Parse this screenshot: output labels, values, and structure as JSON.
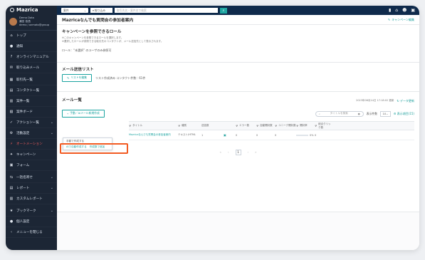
{
  "app": {
    "logo": "Mazrica"
  },
  "user": {
    "line1": "Demo Data",
    "line2": "瀬田 音昌",
    "line3": "demo / azmato@group"
  },
  "sidebar": {
    "items": [
      {
        "label": "トップ",
        "icon": "home-icon"
      },
      {
        "label": "通知",
        "icon": "bell-icon"
      },
      {
        "label": "オンラインマニュアル",
        "icon": "help-icon"
      },
      {
        "label": "取り込みメール",
        "icon": "mail-icon"
      },
      {
        "label": "取引先一覧",
        "icon": "building-icon"
      },
      {
        "label": "コンタクト一覧",
        "icon": "contact-icon"
      },
      {
        "label": "案件一覧",
        "icon": "list-icon"
      },
      {
        "label": "案件ボード",
        "icon": "board-icon"
      },
      {
        "label": "アクション一覧",
        "icon": "check-icon",
        "chevron": true
      },
      {
        "label": "活動設定",
        "icon": "settings-icon",
        "chevron": true
      },
      {
        "label": "オートメーション",
        "icon": "bolt-icon",
        "active": true
      },
      {
        "label": "キャンペーン",
        "icon": "campaign-icon"
      },
      {
        "label": "フォーム",
        "icon": "form-icon"
      },
      {
        "label": "一括名寄せ",
        "icon": "merge-icon",
        "chevron": true
      },
      {
        "label": "レポート",
        "icon": "report-icon",
        "chevron": true
      },
      {
        "label": "カスタムレポート",
        "icon": "chart-icon"
      },
      {
        "label": "ブックマーク",
        "icon": "star-icon",
        "chevron": true
      },
      {
        "label": "個人設定",
        "icon": "person-icon"
      },
      {
        "label": "メニューを閉じる",
        "icon": "back-icon"
      }
    ]
  },
  "topbar": {
    "scope": "案件",
    "filter": "絞り込み",
    "search_placeholder": "取引先名・案件名で検索"
  },
  "page": {
    "title": "Mazricaなんでも質問会の参加者案内",
    "edit": "キャンペーン編集"
  },
  "roles": {
    "heading": "キャンペーンを参照できるロール",
    "desc1": "※このキャンペーンを参照できるロールを選択します。",
    "desc2": "※選択したロールが参照できる取引先のコンタクトが、メール送信先として表示されます。",
    "value": "ロール：“未選択” のユーザのみ参照可"
  },
  "sendlist": {
    "heading": "メール送信リスト",
    "button": "リストを編集",
    "status": "リスト作成済み コンタクト件数：61件"
  },
  "mail": {
    "heading": "メール一覧",
    "timestamp": "2023年06月14日 17:18:02 更新",
    "refresh": "データ更新",
    "create_button": "手動／AIメール新規作成",
    "search_placeholder": "タイトルを検索",
    "per_page_label": "表示件数",
    "per_page": "10",
    "column_settings": "表示項目(15)"
  },
  "menu": {
    "manual": "手動で作成する",
    "ai": "AIで自動作成する",
    "ai_badge": "作成数で追加"
  },
  "table": {
    "headers": [
      "タイトル",
      "種別",
      "送信数",
      "エラー数",
      "自動開封数",
      "ユニーク開封数",
      "開封率",
      "総合クリック数"
    ],
    "rows": [
      {
        "check": "",
        "title": "Mazricaなんでも質問会の参加者案内",
        "type": "テキスト/HTML",
        "sent": "1",
        "error": "0",
        "auto": "0",
        "unique": "0",
        "rate": "0%",
        "clicks": "0"
      }
    ]
  },
  "pager": {
    "first": "«",
    "prev": "‹",
    "current": "1",
    "next": "›",
    "last": "»"
  }
}
